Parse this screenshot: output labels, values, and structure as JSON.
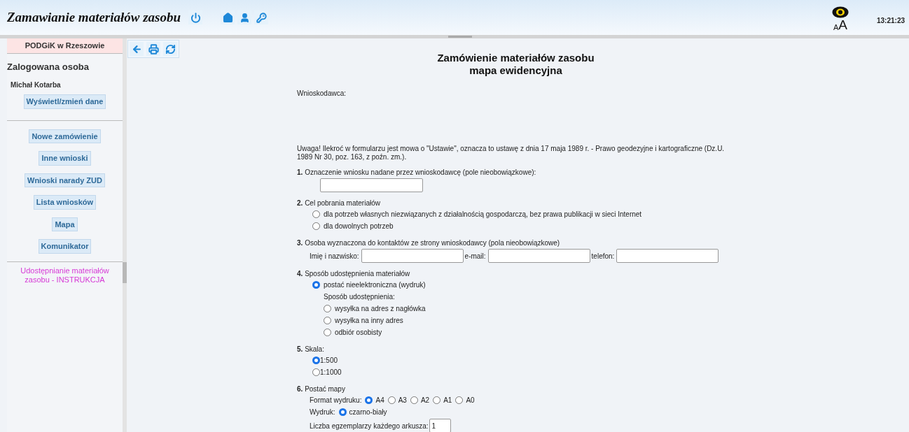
{
  "header": {
    "title": "Zamawianie materiałów zasobu",
    "font_size_small": "A",
    "font_size_large": "A",
    "time": "13:21:23"
  },
  "sidebar": {
    "office": "PODGiK w Rzeszowie",
    "logged_label": "Zalogowana osoba",
    "user_name": "Michał Kotarba",
    "profile_button": "Wyświetl/zmień dane",
    "nav": [
      "Nowe zamówienie",
      "Inne wnioski",
      "Wnioski narady ZUD",
      "Lista wniosków",
      "Mapa",
      "Komunikator"
    ],
    "instruction_link": "Udostępnianie materiałów zasobu - INSTRUKCJA"
  },
  "form": {
    "title": "Zamówienie materiałów zasobu",
    "subtitle": "mapa ewidencyjna",
    "applicant_label": "Wnioskodawca:",
    "notice": "Uwaga! Ilekroć w formularzu jest mowa o \"Ustawie\", oznacza to ustawę z dnia 17 maja 1989 r. - Prawo geodezyjne i kartograficzne (Dz.U. 1989 Nr 30, poz. 163, z poźn. zm.).",
    "sections": [
      {
        "number": "1.",
        "label": "Oznaczenie wniosku nadane przez wnioskodawcę (pole nieobowiązkowe):",
        "content": [
          {
            "kind": "input"
          }
        ]
      },
      {
        "number": "2.",
        "label": "Cel pobrania materiałów",
        "content": [
          {
            "kind": "radio",
            "label": "dla potrzeb własnych niezwiązanych z działalnością gospodarczą, bez prawa publikacji w sieci Internet",
            "selected": false
          },
          {
            "kind": "radio",
            "label": "dla dowolnych potrzeb",
            "selected": false
          }
        ]
      },
      {
        "number": "3.",
        "label": "Osoba wyznaczona do kontaktów ze strony wnioskodawcy (pola nieobowiązkowe)",
        "content": [
          {
            "kind": "fields_row",
            "fields": [
              {
                "label": "Imię i nazwisko:"
              },
              {
                "label": "e-mail:"
              },
              {
                "label": "telefon:"
              }
            ]
          }
        ]
      },
      {
        "number": "4.",
        "label": "Sposób udostępnienia materiałów",
        "content": [
          {
            "kind": "radio",
            "label": "postać nieelektroniczna (wydruk)",
            "selected": true,
            "children": [
              {
                "kind": "subheading",
                "label": "Sposób udostępnienia:"
              },
              {
                "kind": "radio",
                "label": "wysyłka na adres z nagłówka",
                "selected": false
              },
              {
                "kind": "radio",
                "label": "wysyłka na inny adres",
                "selected": false
              },
              {
                "kind": "radio",
                "label": "odbiór osobisty",
                "selected": false
              }
            ]
          }
        ]
      },
      {
        "number": "5.",
        "label": "Skala:",
        "content": [
          {
            "kind": "radio",
            "label": "1:500",
            "selected": true
          },
          {
            "kind": "radio",
            "label": "1:1000",
            "selected": false
          }
        ]
      },
      {
        "number": "6.",
        "label": "Postać mapy",
        "content": [
          {
            "kind": "radio_row",
            "label": "Format wydruku:",
            "options": [
              {
                "label": "A4",
                "selected": true
              },
              {
                "label": "A3",
                "selected": false
              },
              {
                "label": "A2",
                "selected": false
              },
              {
                "label": "A1",
                "selected": false
              },
              {
                "label": "A0",
                "selected": false
              }
            ]
          },
          {
            "kind": "radio_row",
            "label": "Wydruk:",
            "options": [
              {
                "label": "czarno-biały",
                "selected": true
              }
            ]
          },
          {
            "kind": "count",
            "label": "Liczba egzemplarzy każdego arkusza:",
            "value": "1"
          }
        ]
      }
    ]
  }
}
